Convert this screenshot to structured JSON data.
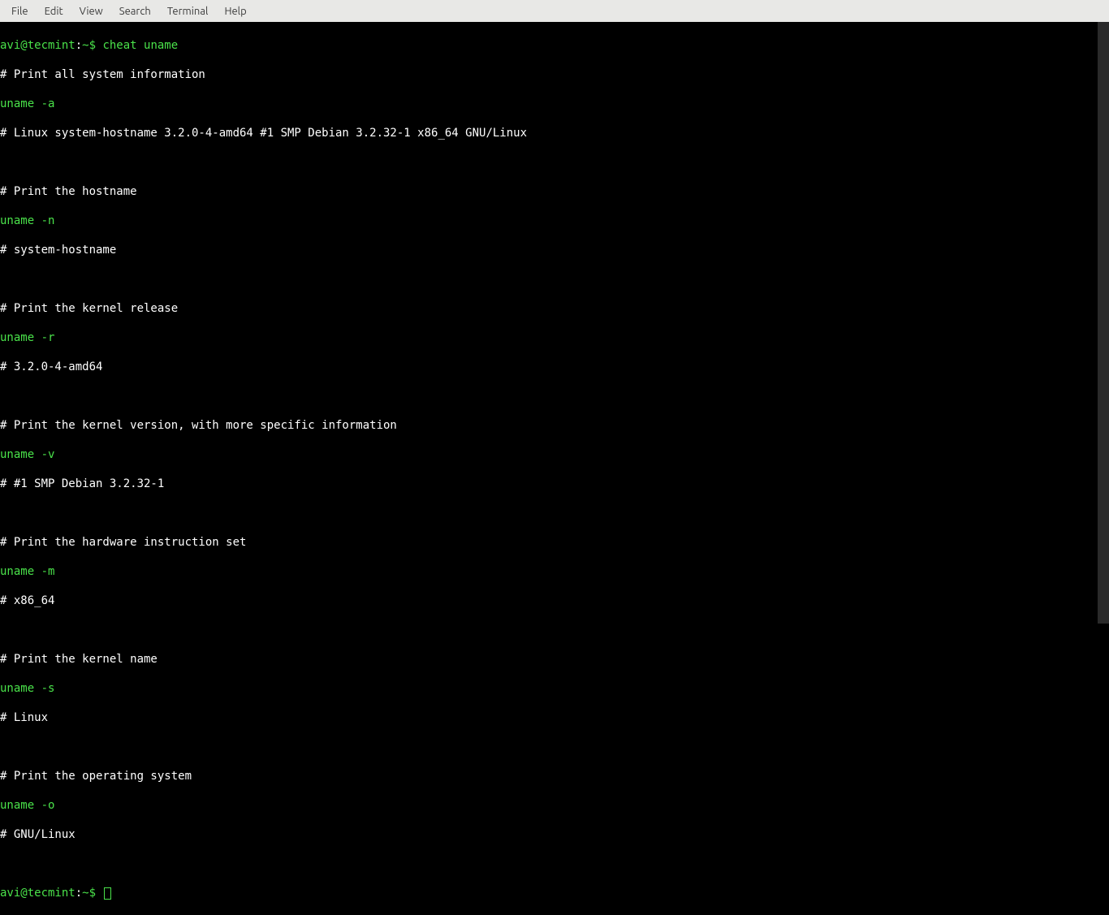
{
  "menubar": {
    "file": "File",
    "edit": "Edit",
    "view": "View",
    "search": "Search",
    "terminal": "Terminal",
    "help": "Help"
  },
  "prompt": {
    "user_host": "avi@tecmint",
    "colon": ":",
    "path": "~",
    "dollar": "$ "
  },
  "command": "cheat uname",
  "lines": {
    "c1": "# Print all system information",
    "g1": "uname -a",
    "o1": "# Linux system-hostname 3.2.0-4-amd64 #1 SMP Debian 3.2.32-1 x86_64 GNU/Linux",
    "c2": "# Print the hostname",
    "g2": "uname -n",
    "o2": "# system-hostname",
    "c3": "# Print the kernel release",
    "g3": "uname -r",
    "o3": "# 3.2.0-4-amd64",
    "c4": "# Print the kernel version, with more specific information",
    "g4": "uname -v",
    "o4": "# #1 SMP Debian 3.2.32-1",
    "c5": "# Print the hardware instruction set",
    "g5": "uname -m",
    "o5": "# x86_64",
    "c6": "# Print the kernel name",
    "g6": "uname -s",
    "o6": "# Linux",
    "c7": "# Print the operating system",
    "g7": "uname -o",
    "o7": "# GNU/Linux"
  }
}
